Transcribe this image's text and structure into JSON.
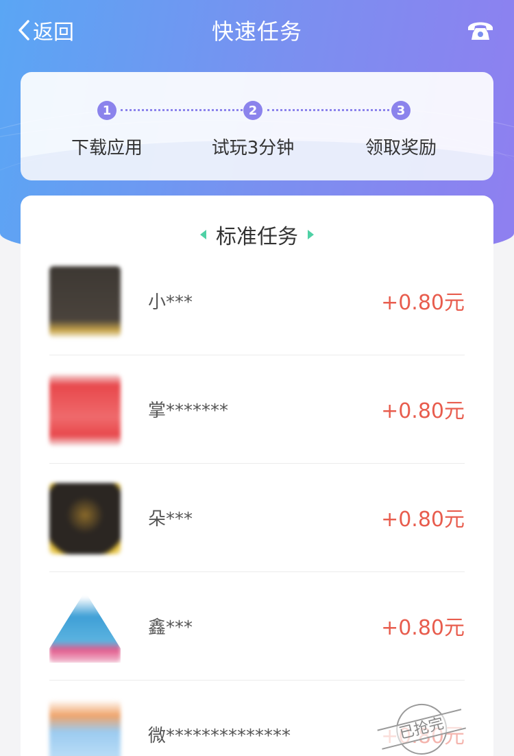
{
  "header": {
    "back_label": "返回",
    "title": "快速任务"
  },
  "steps": [
    {
      "num": "1",
      "label": "下载应用"
    },
    {
      "num": "2",
      "label": "试玩3分钟"
    },
    {
      "num": "3",
      "label": "领取奖励"
    }
  ],
  "section": {
    "title": "标准任务"
  },
  "tasks": [
    {
      "name": "小***",
      "price": "+0.80元",
      "thumb_color": "#3d3833",
      "thumb_accent": "#c9a54a"
    },
    {
      "name": "掌*******",
      "price": "+0.80元",
      "thumb_color": "#e8484c",
      "thumb_accent": "#f2a0a2"
    },
    {
      "name": "朵***",
      "price": "+0.80元",
      "thumb_color": "#2b2622",
      "thumb_accent": "#e6c13a"
    },
    {
      "name": "鑫***",
      "price": "+0.80元",
      "thumb_color": "#3f9fd6",
      "thumb_accent": "#e35b8c"
    },
    {
      "name": "微**************",
      "price": "+0.80元",
      "thumb_color": "#9ccbf0",
      "thumb_accent": "#f0a46a",
      "stamp": "已抢完"
    }
  ],
  "colors": {
    "accent": "#8b83ec",
    "price": "#e85d4e",
    "arrow": "#4fd1a5"
  }
}
